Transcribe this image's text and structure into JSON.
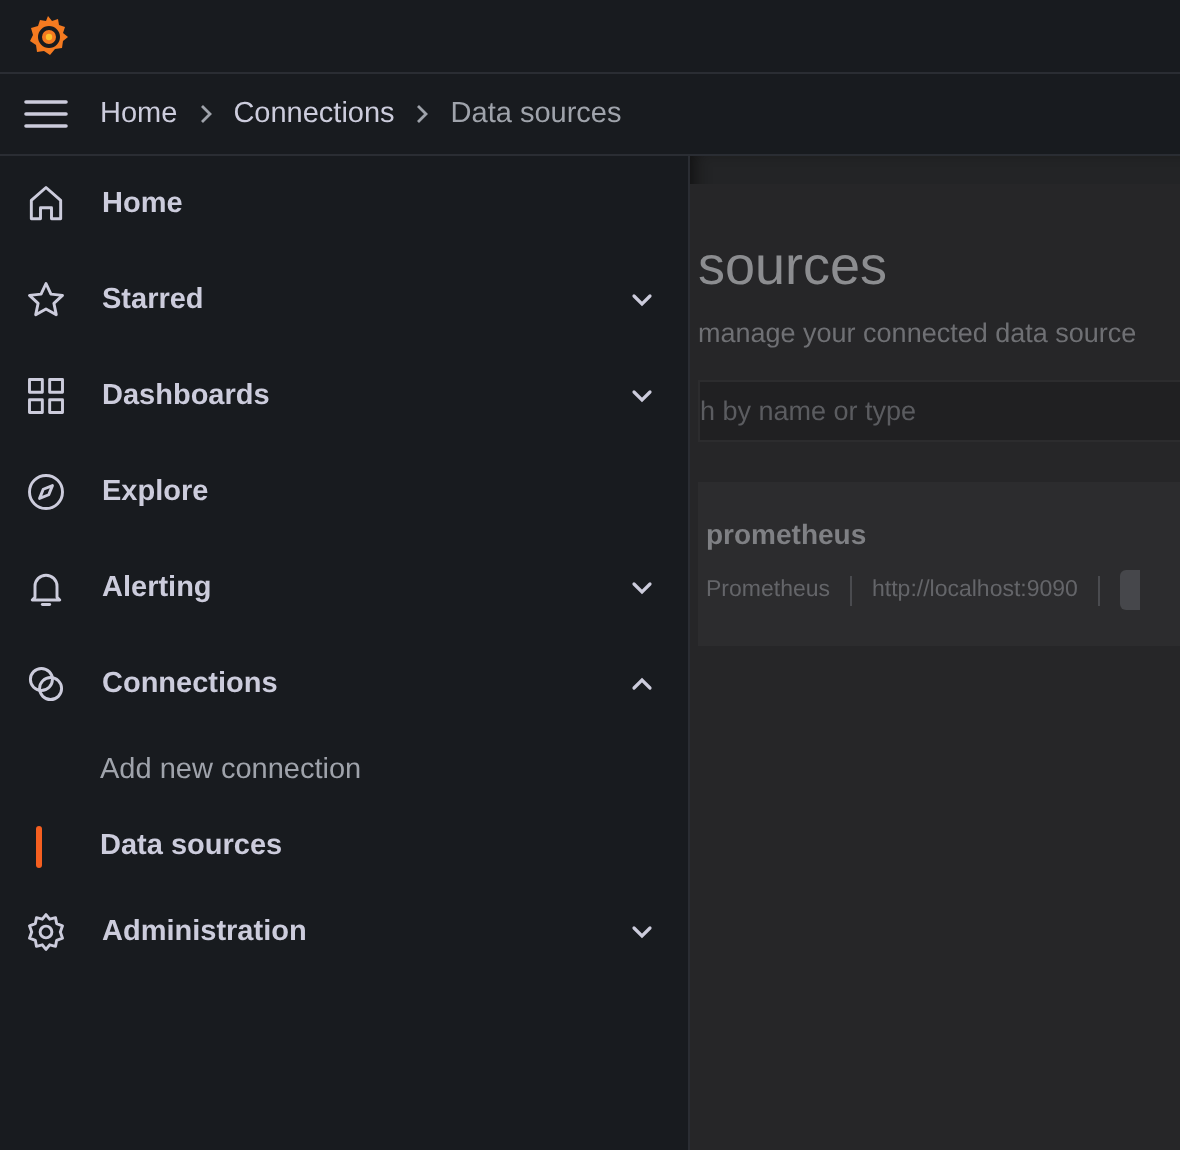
{
  "breadcrumbs": [
    {
      "label": "Home",
      "current": false
    },
    {
      "label": "Connections",
      "current": false
    },
    {
      "label": "Data sources",
      "current": true
    }
  ],
  "nav": [
    {
      "kind": "link",
      "label": "Home"
    },
    {
      "kind": "group",
      "label": "Starred",
      "expanded": false
    },
    {
      "kind": "group",
      "label": "Dashboards",
      "expanded": false
    },
    {
      "kind": "link",
      "label": "Explore"
    },
    {
      "kind": "group",
      "label": "Alerting",
      "expanded": false
    },
    {
      "kind": "group",
      "label": "Connections",
      "expanded": true,
      "children": [
        {
          "label": "Add new connection",
          "selected": false
        },
        {
          "label": "Data sources",
          "selected": true
        }
      ]
    },
    {
      "kind": "group",
      "label": "Administration",
      "expanded": false
    }
  ],
  "page": {
    "title": "sources",
    "subtitle": "manage your connected data source",
    "search": {
      "placeholder": "h by name or type"
    },
    "datasource": {
      "name": "prometheus",
      "type": "Prometheus",
      "url": "http://localhost:9090"
    }
  }
}
